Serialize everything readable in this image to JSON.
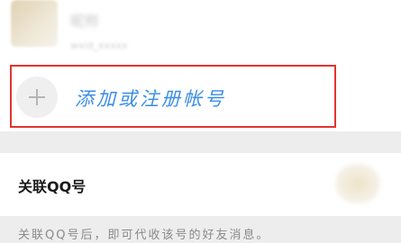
{
  "account": {
    "name": "昵称",
    "id": "wxid_xxxxx"
  },
  "add_account": {
    "label": "添加或注册帐号"
  },
  "linked_qq": {
    "title": "关联QQ号",
    "description": "关联QQ号后，即可代收该号的好友消息。",
    "toggle_on": false
  },
  "colors": {
    "accent": "#3a8ee6",
    "highlight_border": "#e3342f",
    "background": "#ededed"
  }
}
